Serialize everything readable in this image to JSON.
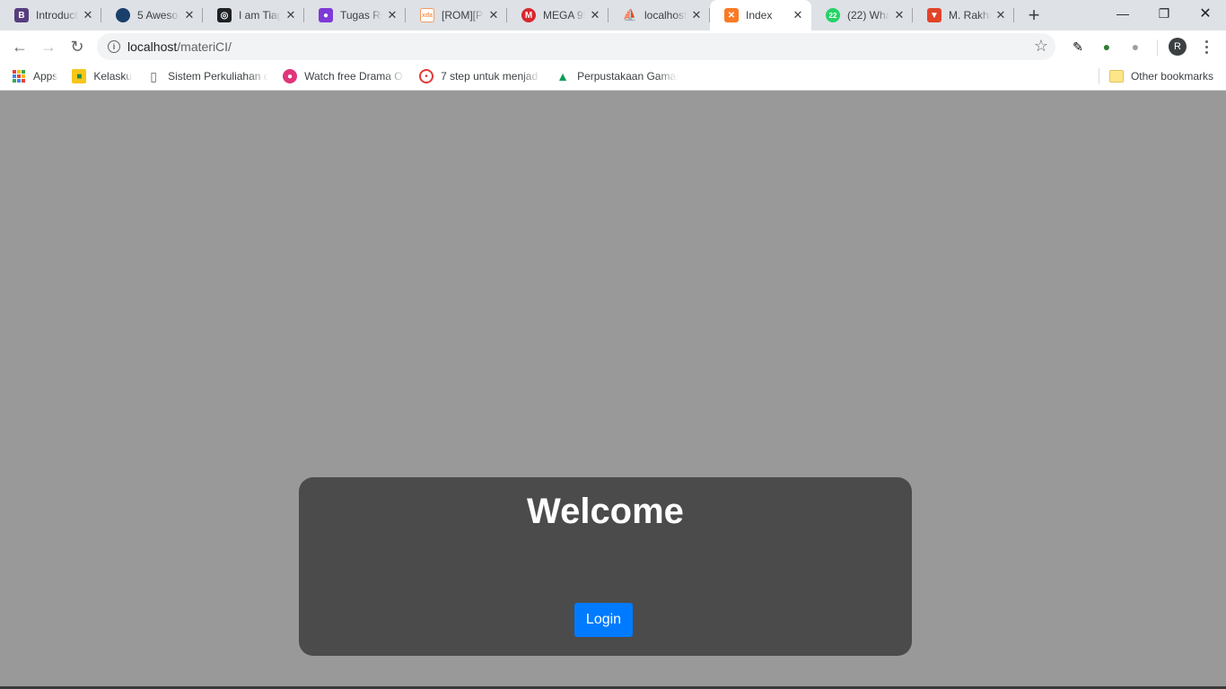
{
  "browser": {
    "tabs": [
      {
        "title": "Introduct",
        "icon": "bootstrap-icon",
        "fav_text": "B",
        "fav_color": "#563d7c"
      },
      {
        "title": "5 Aweso",
        "icon": "globe-icon",
        "fav_text": "",
        "fav_color": "#1a3f6b"
      },
      {
        "title": "I am Tiag",
        "icon": "chat-icon",
        "fav_text": "",
        "fav_color": "#202124"
      },
      {
        "title": "Tugas Re",
        "icon": "classroom-icon",
        "fav_text": "",
        "fav_color": "#7e3ad6"
      },
      {
        "title": "[ROM][P",
        "icon": "xda-icon",
        "fav_text": "xda",
        "fav_color": "#f59a5c"
      },
      {
        "title": "MEGA 95",
        "icon": "mega-icon",
        "fav_text": "M",
        "fav_color": "#d9272e"
      },
      {
        "title": "localhost",
        "icon": "phpmyadmin-icon",
        "fav_text": "",
        "fav_color": "#f29111"
      },
      {
        "title": "Index",
        "icon": "xampp-icon",
        "fav_text": "",
        "fav_color": "#fb7a24",
        "active": true
      },
      {
        "title": "(22) Wha",
        "icon": "whatsapp-icon",
        "fav_text": "22",
        "fav_color": "#25d366"
      },
      {
        "title": "M. Rakha",
        "icon": "gitlab-icon",
        "fav_text": "",
        "fav_color": "#e24329"
      }
    ],
    "url_host": "localhost",
    "url_path": "/materiCI/",
    "profile_initial": "R",
    "bookmarks": [
      {
        "label": "Apps",
        "icon": "apps-grid-icon"
      },
      {
        "label": "Kelasku",
        "icon": "classroom-icon"
      },
      {
        "label": "Sistem Perkuliahan d",
        "icon": "page-icon"
      },
      {
        "label": "Watch free Drama O",
        "icon": "drama-icon"
      },
      {
        "label": "7 step untuk menjad",
        "icon": "target-icon"
      },
      {
        "label": "Perpustakaan Gamap",
        "icon": "google-drive-icon"
      }
    ],
    "other_bookmarks": "Other bookmarks"
  },
  "page": {
    "welcome_title": "Welcome",
    "login_label": "Login",
    "login_color": "#007bff",
    "card_color": "#4b4b4b",
    "background_color": "#999999"
  }
}
